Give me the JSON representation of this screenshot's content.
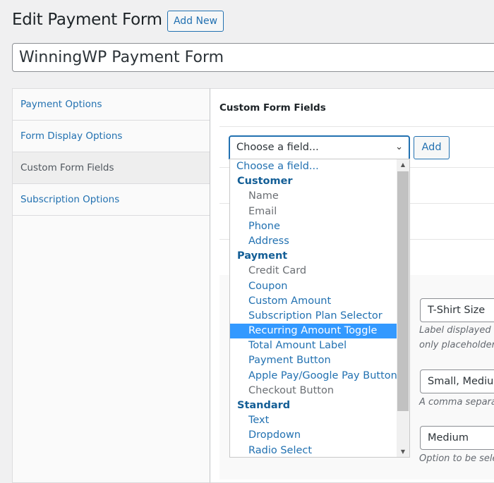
{
  "header": {
    "title": "Edit Payment Form",
    "add_new": "Add New"
  },
  "form_title": "WinningWP Payment Form",
  "sidebar": {
    "tabs": [
      {
        "label": "Payment Options",
        "active": false
      },
      {
        "label": "Form Display Options",
        "active": false
      },
      {
        "label": "Custom Form Fields",
        "active": true
      },
      {
        "label": "Subscription Options",
        "active": false
      }
    ]
  },
  "main": {
    "heading": "Custom Form Fields",
    "select": {
      "value": "Choose a field...",
      "add_label": "Add"
    },
    "options": [
      {
        "label": "Choose a field...",
        "type": "first"
      },
      {
        "label": "Customer",
        "type": "group"
      },
      {
        "label": "Name",
        "type": "disabled"
      },
      {
        "label": "Email",
        "type": "disabled"
      },
      {
        "label": "Phone",
        "type": "option"
      },
      {
        "label": "Address",
        "type": "option"
      },
      {
        "label": "Payment",
        "type": "group"
      },
      {
        "label": "Credit Card",
        "type": "disabled"
      },
      {
        "label": "Coupon",
        "type": "option"
      },
      {
        "label": "Custom Amount",
        "type": "option"
      },
      {
        "label": "Subscription Plan Selector",
        "type": "option"
      },
      {
        "label": "Recurring Amount Toggle",
        "type": "selected"
      },
      {
        "label": "Total Amount Label",
        "type": "option"
      },
      {
        "label": "Payment Button",
        "type": "option"
      },
      {
        "label": "Apple Pay/Google Pay Button",
        "type": "option"
      },
      {
        "label": "Checkout Button",
        "type": "disabled"
      },
      {
        "label": "Standard",
        "type": "group"
      },
      {
        "label": "Text",
        "type": "option"
      },
      {
        "label": "Dropdown",
        "type": "option"
      },
      {
        "label": "Radio Select",
        "type": "option"
      }
    ],
    "fields": {
      "label_value": "T-Shirt Size",
      "label_desc_1": "Label displayed a",
      "label_desc_2": "only placeholders",
      "options_value": "Small, Medium",
      "options_desc": "A comma separa",
      "default_value": "Medium",
      "default_desc": "Option to be sele"
    }
  }
}
